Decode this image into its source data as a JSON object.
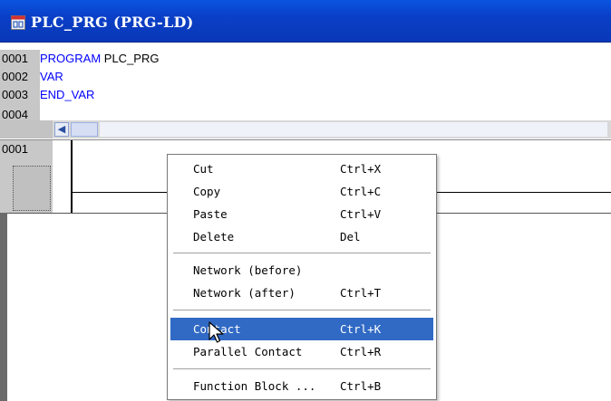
{
  "window": {
    "title": "PLC_PRG (PRG-LD)",
    "title_icon": "ld-editor-icon",
    "colors": {
      "titlebar": "#0a45d0",
      "keyword": "#0000ff",
      "highlight": "#316ac5"
    }
  },
  "declaration": {
    "lines": [
      {
        "num": "0001",
        "keyword": "PROGRAM",
        "text": " PLC_PRG"
      },
      {
        "num": "0002",
        "keyword": "VAR",
        "text": ""
      },
      {
        "num": "0003",
        "keyword": "END_VAR",
        "text": ""
      },
      {
        "num": "0004",
        "keyword": "",
        "text": ""
      }
    ]
  },
  "scrollbar": {
    "left_arrow": "◀"
  },
  "ladder": {
    "network_number": "0001"
  },
  "context_menu": {
    "items": [
      {
        "label": "Cut",
        "shortcut": "Ctrl+X"
      },
      {
        "label": "Copy",
        "shortcut": "Ctrl+C"
      },
      {
        "label": "Paste",
        "shortcut": "Ctrl+V"
      },
      {
        "label": "Delete",
        "shortcut": "Del"
      },
      {
        "label": "Network (before)",
        "shortcut": ""
      },
      {
        "label": "Network (after)",
        "shortcut": "Ctrl+T"
      },
      {
        "label": "Contact",
        "shortcut": "Ctrl+K",
        "highlighted": true
      },
      {
        "label": "Parallel Contact",
        "shortcut": "Ctrl+R"
      },
      {
        "label": "Function Block ...",
        "shortcut": "Ctrl+B"
      }
    ]
  }
}
